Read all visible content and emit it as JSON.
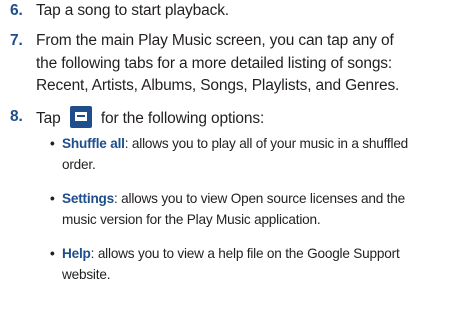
{
  "steps": [
    {
      "number": "6.",
      "text": "Tap a song to start playback."
    },
    {
      "number": "7.",
      "lines": [
        "From the main Play Music screen, you can tap any of",
        "the following tabs for a more detailed listing of songs:",
        "Recent, Artists, Albums, Songs, Playlists, and Genres."
      ]
    },
    {
      "number": "8.",
      "before_icon": "Tap",
      "after_icon": "for the following options:",
      "icon": "menu-icon"
    }
  ],
  "options": [
    {
      "term": "Shuffle all",
      "first_line": ": allows you to play all of your music in a shuffled",
      "rest": "order."
    },
    {
      "term": "Settings",
      "first_line": ": allows you to view Open source licenses and the",
      "rest": "music version for the Play Music application."
    },
    {
      "term": "Help",
      "first_line": ": allows you to view a help file on the Google Support",
      "rest": "website."
    }
  ],
  "colors": {
    "accent": "#1f4e8c",
    "text": "#231f20"
  }
}
